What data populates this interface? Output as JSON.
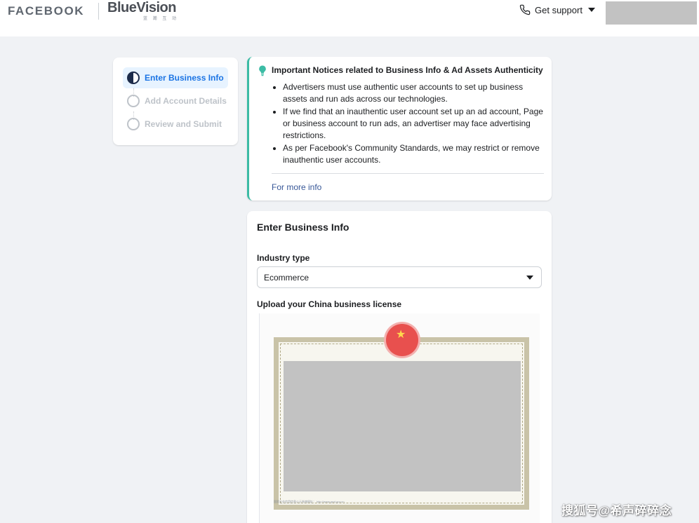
{
  "header": {
    "facebook_logo": "FACEBOOK",
    "partner_logo": "BlueVision",
    "partner_logo_sub": "蓝 瀚 互 动",
    "support_label": "Get support"
  },
  "steps": {
    "items": [
      {
        "label": "Enter Business Info",
        "state": "active"
      },
      {
        "label": "Add Account Details",
        "state": "inactive"
      },
      {
        "label": "Review and Submit",
        "state": "inactive"
      }
    ]
  },
  "notice": {
    "title": "Important Notices related to Business Info & Ad Assets Authenticity",
    "bullets": [
      "Advertisers must use authentic user accounts to set up business assets and run ads across our technologies.",
      "If we find that an inauthentic user account set up an ad account, Page or business account to run ads, an advertiser may face advertising restrictions.",
      "As per Facebook's Community Standards, we may restrict or remove inauthentic user accounts."
    ],
    "more_info": "For more info",
    "accent_color": "#3cbca5"
  },
  "form": {
    "title": "Enter Business Info",
    "industry_label": "Industry type",
    "industry_value": "Ecommerce",
    "license_label": "Upload your China business license",
    "license_footer": "国家企业信用信息公示系统网址： http://www.gsxt.gov.cn"
  },
  "watermark": "搜狐号@希声碎碎念",
  "colors": {
    "background": "#f0f2f5",
    "active_step": "#1b74e4",
    "link": "#385898"
  }
}
